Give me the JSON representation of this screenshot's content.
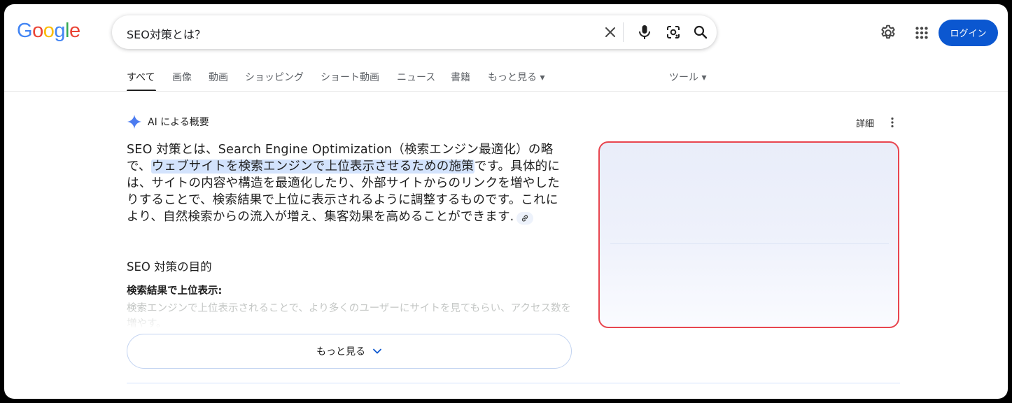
{
  "header": {
    "logo_letters": [
      "G",
      "o",
      "o",
      "g",
      "l",
      "e"
    ],
    "search_query": "SEO対策とは？",
    "login_label": "ログイン"
  },
  "tabs": [
    {
      "label": "すべて",
      "active": true
    },
    {
      "label": "画像"
    },
    {
      "label": "動画"
    },
    {
      "label": "ショッピング"
    },
    {
      "label": "ショート動画"
    },
    {
      "label": "ニュース"
    },
    {
      "label": "書籍"
    },
    {
      "label": "もっと見る ▾"
    }
  ],
  "tools_label": "ツール ▾",
  "ai_overview": {
    "title": "AI による概要",
    "details_label": "詳細",
    "paragraph_before": "SEO 対策とは、Search Engine Optimization（検索エンジン最適化）の略で、",
    "paragraph_highlight": "ウェブサイトを検索エンジンで上位表示させるための施策",
    "paragraph_after": "です。具体的には、サイトの内容や構造を最適化したり、外部サイトからのリンクを増やしたりすることで、検索結果で上位に表示されるように調整するものです。これにより、自然検索からの流入が増え、集客効果を高めることができます.",
    "section_heading": "SEO 対策の目的",
    "bullet_heading": "検索結果で上位表示:",
    "faded_text": "検索エンジンで上位表示されることで、より多くのユーザーにサイトを見てもらい、アクセス数を増やす。",
    "more_label": "もっと見る"
  },
  "colors": {
    "login_bg": "#0b57d0",
    "highlight": "#d3e3fd",
    "panel_border": "#e8454f"
  }
}
